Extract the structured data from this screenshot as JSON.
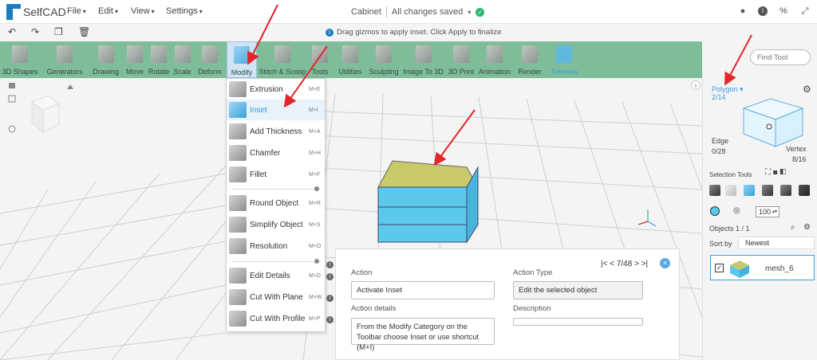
{
  "app": {
    "name": "SelfCAD",
    "doc_title": "Cabinet",
    "save_status": "All changes saved"
  },
  "menus": [
    "File",
    "Edit",
    "View",
    "Settings"
  ],
  "hint": "Drag gizmos to apply inset. Click Apply to finalize",
  "toolbar": {
    "tools": [
      "3D Shapes",
      "Generators",
      "Drawing",
      "Move",
      "Rotate",
      "Scale",
      "Deform",
      "Modify",
      "Stitch & Scoop",
      "Tools",
      "Utilities",
      "Sculpting",
      "Image To 3D",
      "3D Print",
      "Animation",
      "Render",
      "Tutorials"
    ],
    "find_placeholder": "Find Tool"
  },
  "modify_menu": {
    "items": [
      {
        "label": "Extrusion",
        "key": "M+E"
      },
      {
        "label": "Inset",
        "key": "M+I"
      },
      {
        "label": "Add Thickness",
        "key": "M+A"
      },
      {
        "label": "Chamfer",
        "key": "M+H"
      },
      {
        "label": "Fillet",
        "key": "M+F"
      },
      {
        "label": "Round Object",
        "key": "M+R"
      },
      {
        "label": "Simplify Object",
        "key": "M+S"
      },
      {
        "label": "Resolution",
        "key": "M+O"
      },
      {
        "label": "Edit Details",
        "key": "M+D"
      },
      {
        "label": "Cut With Plane",
        "key": "M+W"
      },
      {
        "label": "Cut With Profile",
        "key": "M+P"
      }
    ]
  },
  "tutorial": {
    "action_label": "Action",
    "action_value": "Activate Inset",
    "details_label": "Action details",
    "details_value": "From the Modify Category on the Toolbar choose Inset or use shortcut (M+I)",
    "type_label": "Action Type",
    "type_value": "Edit the selected object",
    "description_label": "Description",
    "description_value": "",
    "step": "7/48"
  },
  "right_panel": {
    "polygon_label": "Polygon",
    "polygon_count": "2/14",
    "edge_label": "Edge",
    "edge_count": "0/28",
    "vertex_label": "Vertex",
    "vertex_count": "8/16",
    "selection_tools_label": "Selection Tools",
    "size_value": "100",
    "objects_label": "Objects 1 / 1",
    "sort_label": "Sort by",
    "sort_value": "Newest",
    "object_name": "mesh_6"
  },
  "colors": {
    "toolbar_bg": "#7fbd9a",
    "accent": "#3a9be0",
    "mesh_side": "#5bc8ec",
    "mesh_top": "#c8c96b",
    "annotation": "#e3262b"
  }
}
